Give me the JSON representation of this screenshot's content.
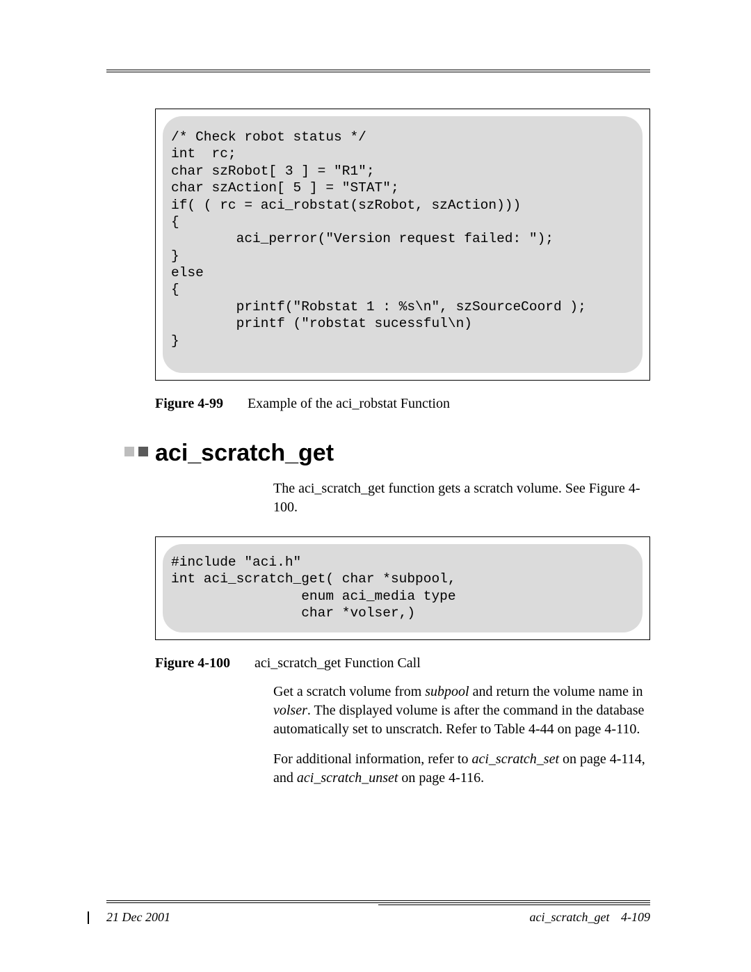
{
  "code_block_1": "/* Check robot status */\nint  rc;\nchar szRobot[ 3 ] = \"R1\";\nchar szAction[ 5 ] = \"STAT\";\nif( ( rc = aci_robstat(szRobot, szAction)))\n{\n        aci_perror(\"Version request failed: \");\n}\nelse\n{\n        printf(\"Robstat 1 : %s\\n\", szSourceCoord );\n        printf (\"robstat sucessful\\n)\n}",
  "figure_99": {
    "label": "Figure 4-99",
    "caption": "Example of the aci_robstat Function"
  },
  "section_heading": "aci_scratch_get",
  "intro_para_1a": "The aci_scratch_get function gets a scratch volume. See ",
  "intro_para_1b": "Figure 4-100",
  "intro_para_1c": ".",
  "code_block_2": "#include \"aci.h\"\nint aci_scratch_get( char *subpool,\n                enum aci_media type\n                char *volser,)",
  "figure_100": {
    "label": "Figure 4-100",
    "caption": "aci_scratch_get Function Call"
  },
  "body_p1_a": "Get a scratch volume from ",
  "body_p1_subpool": "subpool",
  "body_p1_b": " and return the volume name in ",
  "body_p1_volser": "volser",
  "body_p1_c": ". The displayed volume is after the command in the database automatically set to unscratch. Refer to ",
  "body_p1_d": "Table 4-44 on page 4-110.",
  "body_p2_a": "For additional information, refer to ",
  "body_p2_set": "aci_scratch_set",
  "body_p2_b": "  on page 4-114, and ",
  "body_p2_unset": "aci_scratch_unset",
  "body_p2_c": "  on page 4-116.",
  "footer": {
    "date": "21 Dec 2001",
    "section": "aci_scratch_get",
    "page": "4-109"
  }
}
